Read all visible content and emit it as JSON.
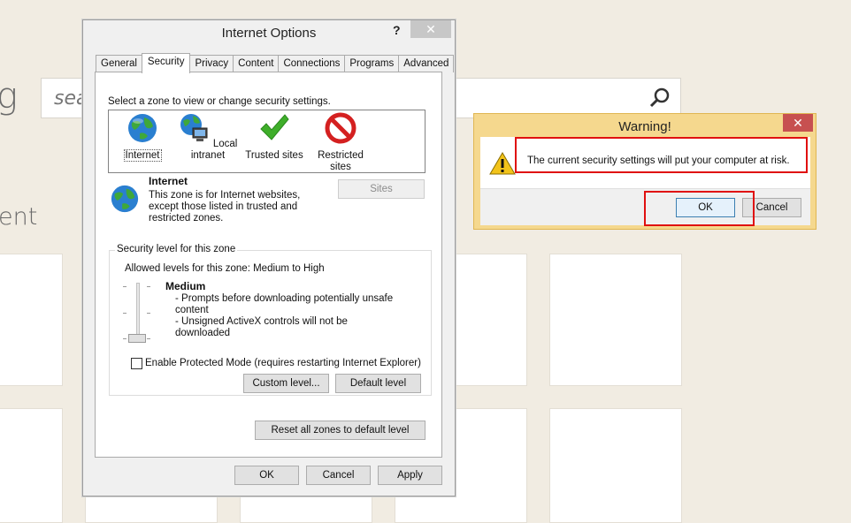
{
  "background": {
    "partial_title": "g",
    "partial_subtitle": "ent",
    "search_placeholder": "sea"
  },
  "internet_options": {
    "title": "Internet Options",
    "help_label": "?",
    "tabs": [
      {
        "label": "General"
      },
      {
        "label": "Security"
      },
      {
        "label": "Privacy"
      },
      {
        "label": "Content"
      },
      {
        "label": "Connections"
      },
      {
        "label": "Programs"
      },
      {
        "label": "Advanced"
      }
    ],
    "active_tab": "Security",
    "zone_prompt": "Select a zone to view or change security settings.",
    "zones": [
      {
        "label": "Internet",
        "icon": "globe-icon"
      },
      {
        "label": "Local intranet",
        "icon": "intranet-icon"
      },
      {
        "label": "Trusted sites",
        "icon": "checkmark-icon"
      },
      {
        "label": "Restricted sites",
        "icon": "restricted-icon"
      }
    ],
    "selected_zone": {
      "name": "Internet",
      "description": "This zone is for Internet websites, except those listed in trusted and restricted zones."
    },
    "sites_button": "Sites",
    "security_level": {
      "group_title": "Security level for this zone",
      "allowed": "Allowed levels for this zone: Medium to High",
      "level_name": "Medium",
      "bullet_1": "- Prompts before downloading potentially unsafe content",
      "bullet_2": "- Unsigned ActiveX controls will not be downloaded",
      "protected_mode_label": "Enable Protected Mode (requires restarting Internet Explorer)",
      "protected_mode_checked": false,
      "custom_level_button": "Custom level...",
      "default_level_button": "Default level"
    },
    "reset_all_button": "Reset all zones to default level",
    "ok_button": "OK",
    "cancel_button": "Cancel",
    "apply_button": "Apply"
  },
  "warning": {
    "title": "Warning!",
    "message": "The current security settings will put your computer at risk.",
    "ok_button": "OK",
    "cancel_button": "Cancel",
    "highlight_color": "#e01010"
  },
  "colors": {
    "background": "#f1ece2",
    "warning_frame": "#f5d88e",
    "close_button_red": "#c75050"
  }
}
